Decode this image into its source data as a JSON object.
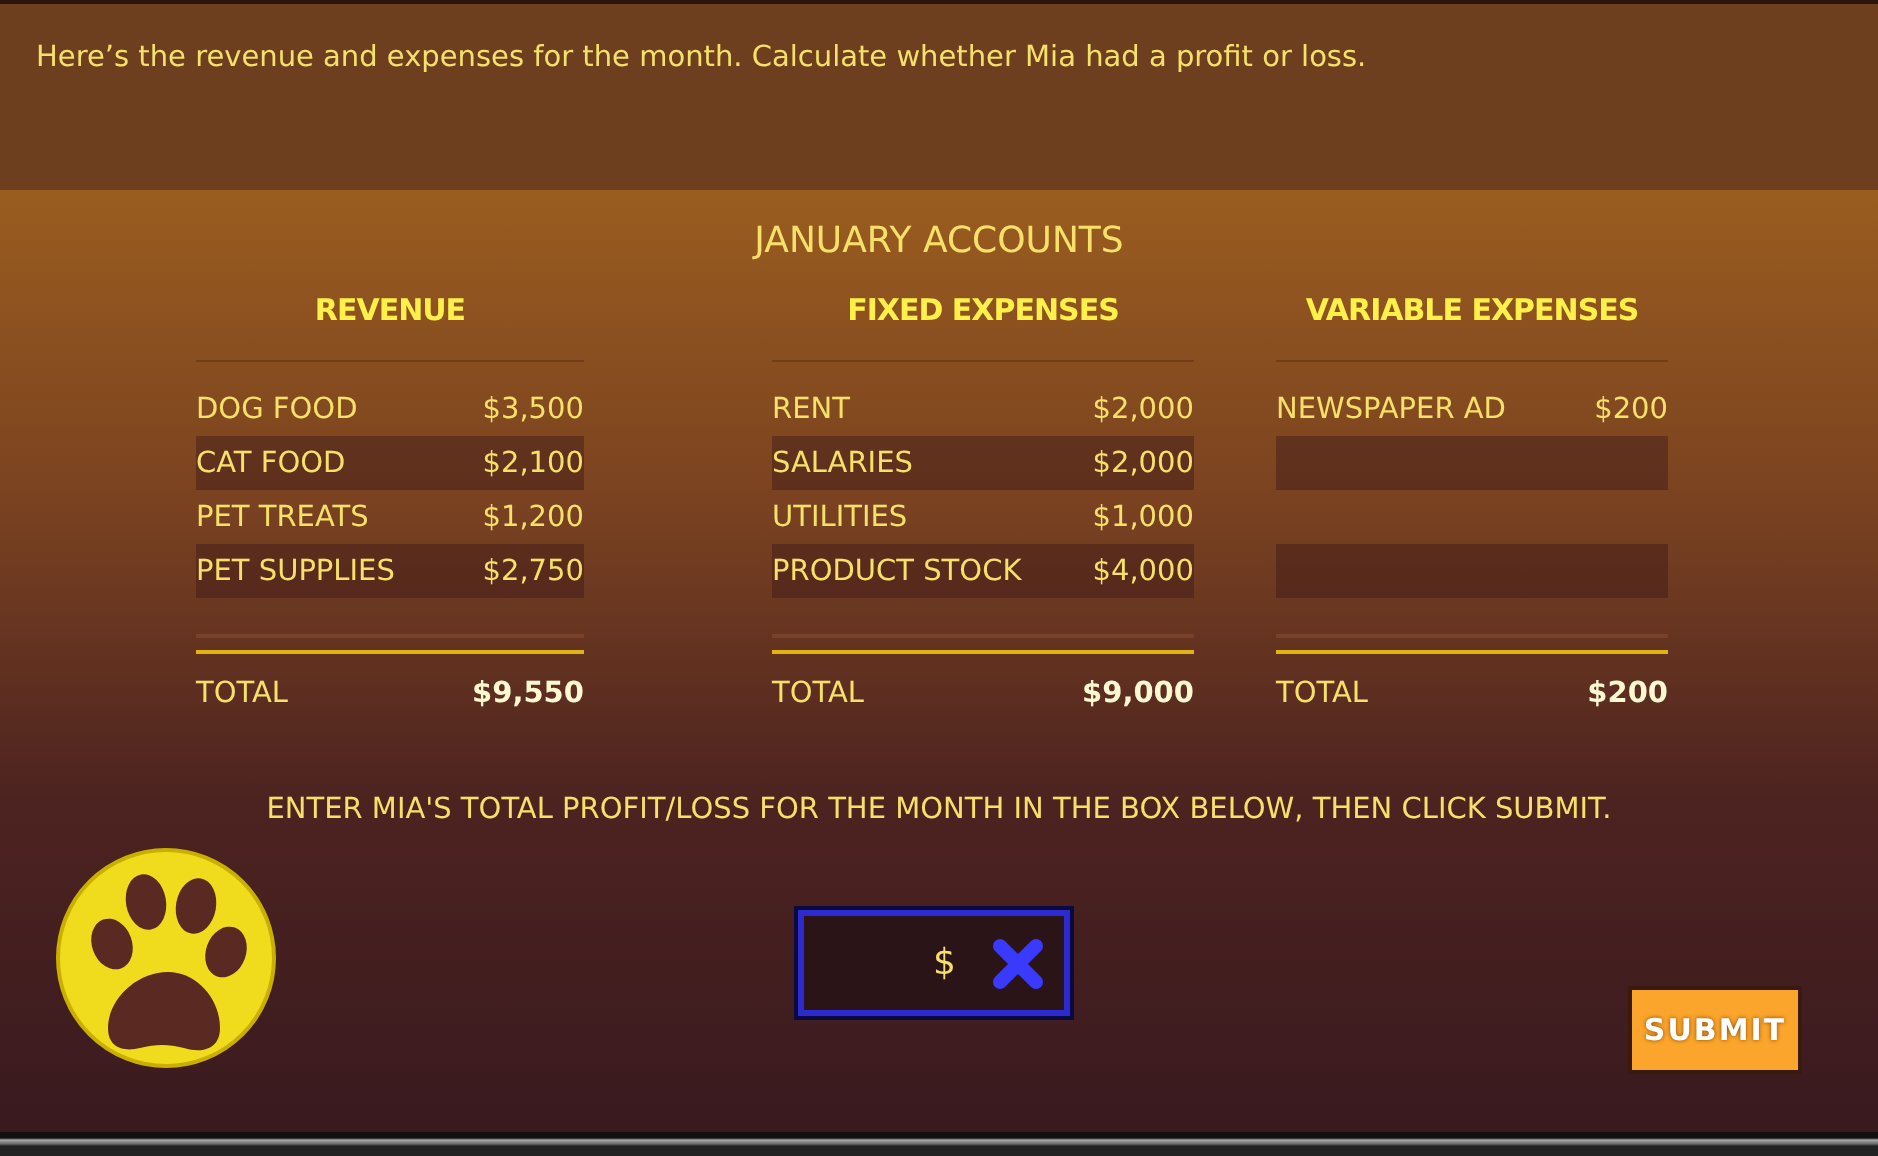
{
  "instruction": "Here’s the revenue and expenses for the month. Calculate whether Mia had a profit or loss.",
  "title": "JANUARY ACCOUNTS",
  "columns": [
    {
      "heading": "REVENUE",
      "rows": [
        {
          "label": "DOG FOOD",
          "amount": "$3,500"
        },
        {
          "label": "CAT FOOD",
          "amount": "$2,100"
        },
        {
          "label": "PET TREATS",
          "amount": "$1,200"
        },
        {
          "label": "PET SUPPLIES",
          "amount": "$2,750"
        }
      ],
      "total_label": "TOTAL",
      "total_amount": "$9,550"
    },
    {
      "heading": "FIXED EXPENSES",
      "rows": [
        {
          "label": "RENT",
          "amount": "$2,000"
        },
        {
          "label": "SALARIES",
          "amount": "$2,000"
        },
        {
          "label": "UTILITIES",
          "amount": "$1,000"
        },
        {
          "label": "PRODUCT STOCK",
          "amount": "$4,000"
        }
      ],
      "total_label": "TOTAL",
      "total_amount": "$9,000"
    },
    {
      "heading": "VARIABLE EXPENSES",
      "rows": [
        {
          "label": "NEWSPAPER AD",
          "amount": "$200"
        }
      ],
      "total_label": "TOTAL",
      "total_amount": "$200"
    }
  ],
  "prompt": "ENTER MIA'S TOTAL PROFIT/LOSS FOR THE MONTH IN THE BOX BELOW, THEN CLICK SUBMIT.",
  "answer": {
    "prefix": "$"
  },
  "submit": "SUBMIT"
}
